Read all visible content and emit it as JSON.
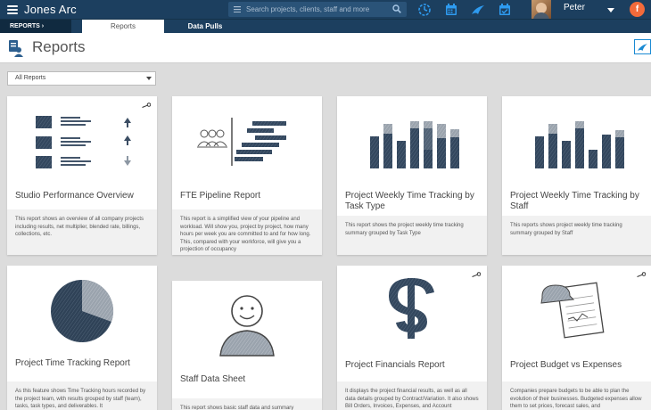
{
  "topbar": {
    "app_title": "Jones Arc",
    "search_placeholder": "Search projects, clients, staff and more",
    "icons": [
      "timer-icon",
      "calendar-icon",
      "tracking-icon",
      "calendar-check-icon"
    ],
    "user_name": "Peter",
    "brand_letter": "f"
  },
  "subnav": {
    "crumb": "REPORTS ›",
    "tabs": [
      {
        "label": "Reports",
        "active": true
      },
      {
        "label": "Data Pulls",
        "active": false
      }
    ]
  },
  "page": {
    "title": "Reports"
  },
  "filter": {
    "selected": "All Reports"
  },
  "cards": [
    {
      "title": "Studio Performance Overview",
      "desc": "This report shows an overview of all company projects including results, net multiplier, blended rate, billings, collections, etc.",
      "thumb": "studio-performance-icon",
      "locked": true
    },
    {
      "title": "FTE Pipeline Report",
      "desc": "This report is a simplified view of your pipeline and workload. Will show you, project by project, how many hours per week you are committed to and for how long. This, compared with your workforce, will give you a projection of occupancy",
      "thumb": "pipeline-icon",
      "locked": false
    },
    {
      "title": "Project Weekly Time Tracking by Task Type",
      "desc": "This report shows the project weekly time tracking summary grouped by Task Type",
      "thumb": "bar-chart-icon",
      "locked": false
    },
    {
      "title": "Project Weekly Time Tracking by Staff",
      "desc": "This reports shows project weekly time tracking summary grouped by Staff",
      "thumb": "bar-chart-icon",
      "locked": false
    },
    {
      "title": "Project Time Tracking Report",
      "desc": "As this feature shows Time Tracking hours recorded by the project team, with results grouped by staff (team), tasks, task types, and deliverables. It",
      "thumb": "pie-chart-icon",
      "locked": false
    },
    {
      "title": "Staff Data Sheet",
      "desc": "This report shows basic staff data and summary",
      "thumb": "person-icon",
      "locked": false
    },
    {
      "title": "Project Financials Report",
      "desc": "It displays the project financial results, as well as all data details grouped by Contract/Variation. It also shows Bill Orders, Invoices, Expenses, and Account",
      "thumb": "dollar-icon",
      "locked": true
    },
    {
      "title": "Project Budget vs Expenses",
      "desc": "Companies prepare budgets to be able to plan the evolution of their businesses. Budgeted expenses allow them to set prices, forecast sales, and",
      "thumb": "clipboard-icon",
      "locked": true
    }
  ]
}
